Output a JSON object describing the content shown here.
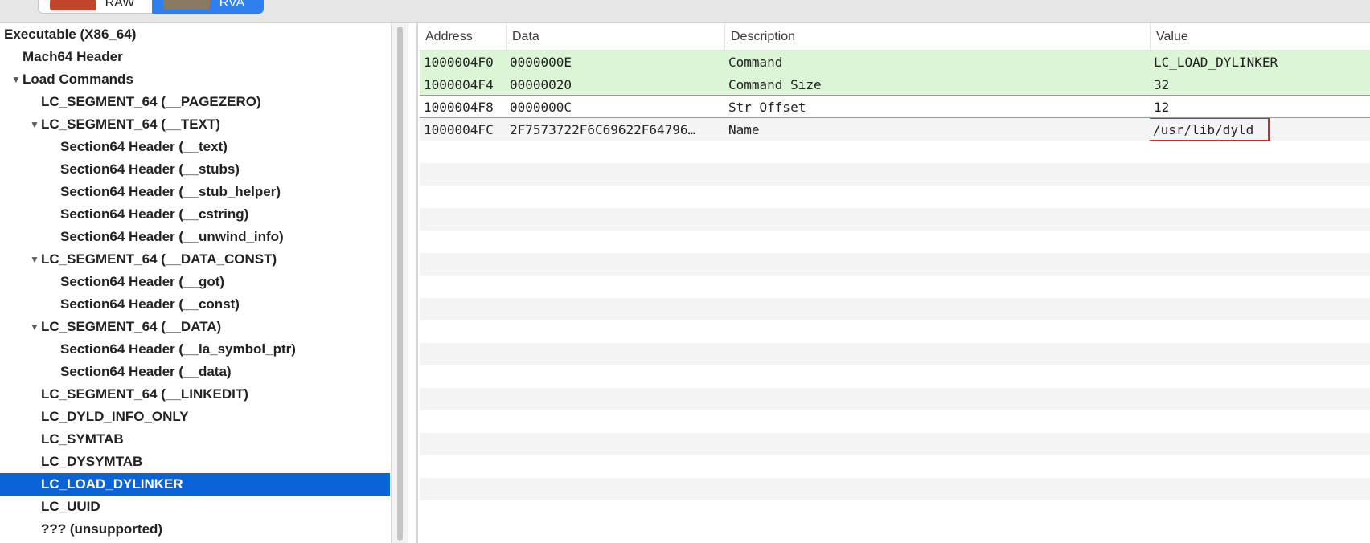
{
  "toolbar": {
    "raw_label": "RAW",
    "rva_label": "RVA",
    "selected": "RVA"
  },
  "tree": {
    "items": [
      {
        "label": "Executable  (X86_64)",
        "level": 0,
        "expanded": null,
        "selected": false
      },
      {
        "label": "Mach64 Header",
        "level": 1,
        "expanded": null,
        "selected": false
      },
      {
        "label": "Load Commands",
        "level": 1,
        "expanded": true,
        "selected": false
      },
      {
        "label": "LC_SEGMENT_64 (__PAGEZERO)",
        "level": 2,
        "expanded": null,
        "selected": false
      },
      {
        "label": "LC_SEGMENT_64 (__TEXT)",
        "level": 2,
        "expanded": true,
        "selected": false
      },
      {
        "label": "Section64 Header (__text)",
        "level": 3,
        "expanded": null,
        "selected": false
      },
      {
        "label": "Section64 Header (__stubs)",
        "level": 3,
        "expanded": null,
        "selected": false
      },
      {
        "label": "Section64 Header (__stub_helper)",
        "level": 3,
        "expanded": null,
        "selected": false
      },
      {
        "label": "Section64 Header (__cstring)",
        "level": 3,
        "expanded": null,
        "selected": false
      },
      {
        "label": "Section64 Header (__unwind_info)",
        "level": 3,
        "expanded": null,
        "selected": false
      },
      {
        "label": "LC_SEGMENT_64 (__DATA_CONST)",
        "level": 2,
        "expanded": true,
        "selected": false
      },
      {
        "label": "Section64 Header (__got)",
        "level": 3,
        "expanded": null,
        "selected": false
      },
      {
        "label": "Section64 Header (__const)",
        "level": 3,
        "expanded": null,
        "selected": false
      },
      {
        "label": "LC_SEGMENT_64 (__DATA)",
        "level": 2,
        "expanded": true,
        "selected": false
      },
      {
        "label": "Section64 Header (__la_symbol_ptr)",
        "level": 3,
        "expanded": null,
        "selected": false
      },
      {
        "label": "Section64 Header (__data)",
        "level": 3,
        "expanded": null,
        "selected": false
      },
      {
        "label": "LC_SEGMENT_64 (__LINKEDIT)",
        "level": 2,
        "expanded": null,
        "selected": false
      },
      {
        "label": "LC_DYLD_INFO_ONLY",
        "level": 2,
        "expanded": null,
        "selected": false
      },
      {
        "label": "LC_SYMTAB",
        "level": 2,
        "expanded": null,
        "selected": false
      },
      {
        "label": "LC_DYSYMTAB",
        "level": 2,
        "expanded": null,
        "selected": false
      },
      {
        "label": "LC_LOAD_DYLINKER",
        "level": 2,
        "expanded": null,
        "selected": true
      },
      {
        "label": "LC_UUID",
        "level": 2,
        "expanded": null,
        "selected": false
      },
      {
        "label": "??? (unsupported)",
        "level": 2,
        "expanded": null,
        "selected": false
      }
    ]
  },
  "table": {
    "columns": [
      "Address",
      "Data",
      "Description",
      "Value"
    ],
    "rows": [
      {
        "address": "1000004F0",
        "data": "0000000E",
        "description": "Command",
        "value": "LC_LOAD_DYLINKER",
        "highlight": true
      },
      {
        "address": "1000004F4",
        "data": "00000020",
        "description": "Command Size",
        "value": "32",
        "highlight": true
      },
      {
        "address": "1000004F8",
        "data": "0000000C",
        "description": "Str Offset",
        "value": "12",
        "highlight": false
      },
      {
        "address": "1000004FC",
        "data": "2F7573722F6C69622F64796…",
        "description": "Name",
        "value": "/usr/lib/dyld",
        "highlight": false,
        "boxed": true
      }
    ],
    "empty_rows": 17
  },
  "colors": {
    "selection": "#0a63d6",
    "highlight_row": "#dbf5d6",
    "annotation_box": "#e02020",
    "segment_active": "#2e80ef"
  }
}
